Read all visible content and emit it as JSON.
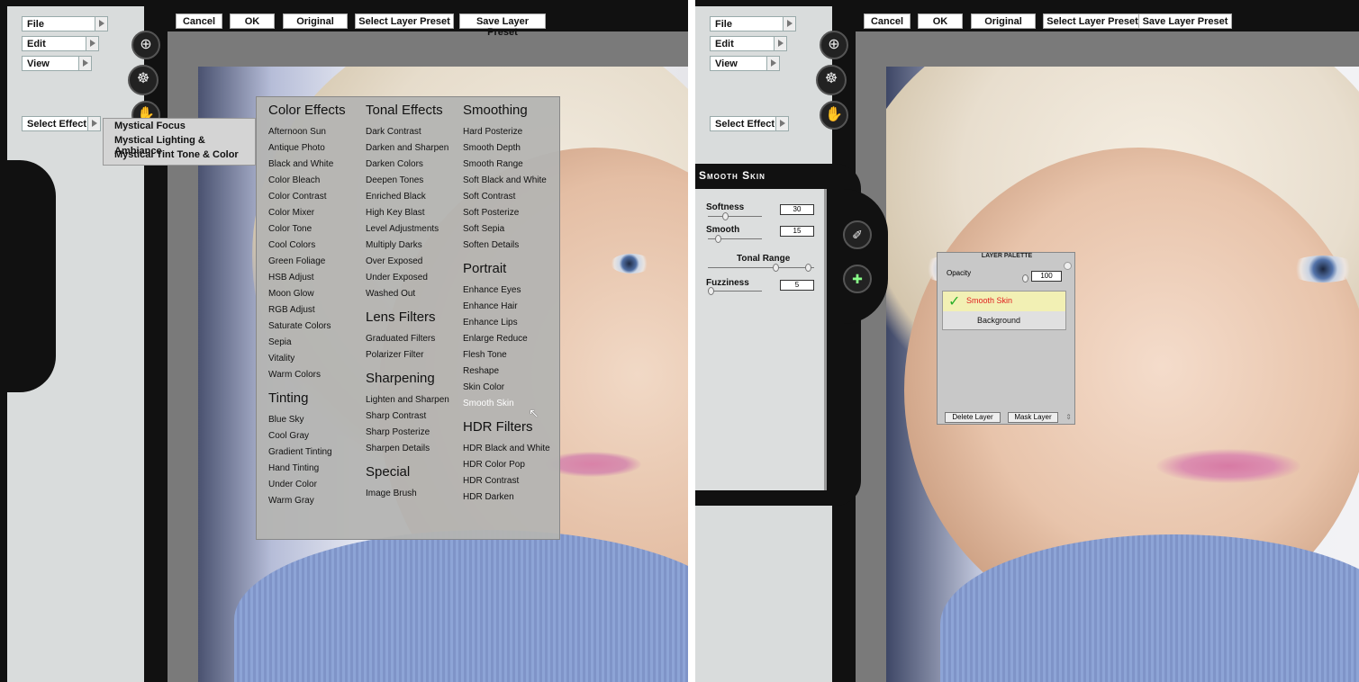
{
  "left": {
    "menus": [
      "File",
      "Edit",
      "View"
    ],
    "select_effect": "Select Effect",
    "toolbar": [
      "Cancel",
      "OK",
      "Original",
      "Select Layer Preset",
      "Save Layer Preset"
    ],
    "submenu": [
      "Mystical Focus",
      "Mystical Lighting & Ambiance",
      "Mystical Tint Tone & Color"
    ],
    "effects_columns": [
      [
        {
          "type": "h",
          "text": "Color Effects"
        },
        {
          "type": "i",
          "text": "Afternoon Sun"
        },
        {
          "type": "i",
          "text": "Antique Photo"
        },
        {
          "type": "i",
          "text": "Black and White"
        },
        {
          "type": "i",
          "text": "Color Bleach"
        },
        {
          "type": "i",
          "text": "Color Contrast"
        },
        {
          "type": "i",
          "text": "Color Mixer"
        },
        {
          "type": "i",
          "text": "Color Tone"
        },
        {
          "type": "i",
          "text": "Cool Colors"
        },
        {
          "type": "i",
          "text": "Green Foliage"
        },
        {
          "type": "i",
          "text": "HSB Adjust"
        },
        {
          "type": "i",
          "text": "Moon Glow"
        },
        {
          "type": "i",
          "text": "RGB Adjust"
        },
        {
          "type": "i",
          "text": "Saturate Colors"
        },
        {
          "type": "i",
          "text": "Sepia"
        },
        {
          "type": "i",
          "text": "Vitality"
        },
        {
          "type": "i",
          "text": "Warm Colors"
        },
        {
          "type": "gap"
        },
        {
          "type": "h",
          "text": "Tinting"
        },
        {
          "type": "i",
          "text": "Blue Sky"
        },
        {
          "type": "i",
          "text": "Cool Gray"
        },
        {
          "type": "i",
          "text": "Gradient Tinting"
        },
        {
          "type": "i",
          "text": "Hand Tinting"
        },
        {
          "type": "i",
          "text": "Under Color"
        },
        {
          "type": "i",
          "text": "Warm Gray"
        }
      ],
      [
        {
          "type": "h",
          "text": "Tonal Effects"
        },
        {
          "type": "i",
          "text": "Dark Contrast"
        },
        {
          "type": "i",
          "text": "Darken and Sharpen"
        },
        {
          "type": "i",
          "text": "Darken Colors"
        },
        {
          "type": "i",
          "text": "Deepen Tones"
        },
        {
          "type": "i",
          "text": "Enriched Black"
        },
        {
          "type": "i",
          "text": "High Key Blast"
        },
        {
          "type": "i",
          "text": "Level Adjustments"
        },
        {
          "type": "i",
          "text": "Multiply Darks"
        },
        {
          "type": "i",
          "text": "Over Exposed"
        },
        {
          "type": "i",
          "text": "Under Exposed"
        },
        {
          "type": "i",
          "text": "Washed Out"
        },
        {
          "type": "gap"
        },
        {
          "type": "h",
          "text": "Lens Filters"
        },
        {
          "type": "i",
          "text": "Graduated Filters"
        },
        {
          "type": "i",
          "text": "Polarizer Filter"
        },
        {
          "type": "gap"
        },
        {
          "type": "h",
          "text": "Sharpening"
        },
        {
          "type": "i",
          "text": "Lighten and Sharpen"
        },
        {
          "type": "i",
          "text": "Sharp Contrast"
        },
        {
          "type": "i",
          "text": "Sharp Posterize"
        },
        {
          "type": "i",
          "text": "Sharpen Details"
        },
        {
          "type": "gap"
        },
        {
          "type": "h",
          "text": "Special"
        },
        {
          "type": "i",
          "text": "Image Brush"
        }
      ],
      [
        {
          "type": "h",
          "text": "Smoothing"
        },
        {
          "type": "i",
          "text": "Hard Posterize"
        },
        {
          "type": "i",
          "text": "Smooth Depth"
        },
        {
          "type": "i",
          "text": "Smooth Range"
        },
        {
          "type": "i",
          "text": "Soft Black and White"
        },
        {
          "type": "i",
          "text": "Soft Contrast"
        },
        {
          "type": "i",
          "text": "Soft Posterize"
        },
        {
          "type": "i",
          "text": "Soft Sepia"
        },
        {
          "type": "i",
          "text": "Soften Details"
        },
        {
          "type": "gap"
        },
        {
          "type": "h",
          "text": "Portrait"
        },
        {
          "type": "i",
          "text": "Enhance Eyes"
        },
        {
          "type": "i",
          "text": "Enhance Hair"
        },
        {
          "type": "i",
          "text": "Enhance Lips"
        },
        {
          "type": "i",
          "text": "Enlarge Reduce"
        },
        {
          "type": "i",
          "text": "Flesh Tone"
        },
        {
          "type": "i",
          "text": "Reshape"
        },
        {
          "type": "i",
          "text": "Skin Color"
        },
        {
          "type": "i",
          "text": "Smooth Skin",
          "hl": true
        },
        {
          "type": "gap"
        },
        {
          "type": "h",
          "text": "HDR Filters"
        },
        {
          "type": "i",
          "text": "HDR Black and White"
        },
        {
          "type": "i",
          "text": "HDR Color Pop"
        },
        {
          "type": "i",
          "text": "HDR Contrast"
        },
        {
          "type": "i",
          "text": "HDR Darken"
        }
      ]
    ]
  },
  "right": {
    "menus": [
      "File",
      "Edit",
      "View"
    ],
    "select_effect": "Select Effect",
    "toolbar": [
      "Cancel",
      "OK",
      "Original",
      "Select Layer Preset",
      "Save Layer Preset"
    ],
    "effect_title": "Smooth Skin",
    "sliders": {
      "softness_label": "Softness",
      "softness_value": "30",
      "smooth_label": "Smooth",
      "smooth_value": "15",
      "tonal_label": "Tonal Range",
      "fuzziness_label": "Fuzziness",
      "fuzziness_value": "5"
    },
    "layer_palette": {
      "title": "LAYER PALETTE",
      "opacity_label": "Opacity",
      "opacity_value": "100",
      "layers": [
        "Smooth Skin",
        "Background"
      ],
      "delete": "Delete Layer",
      "mask": "Mask Layer"
    }
  }
}
